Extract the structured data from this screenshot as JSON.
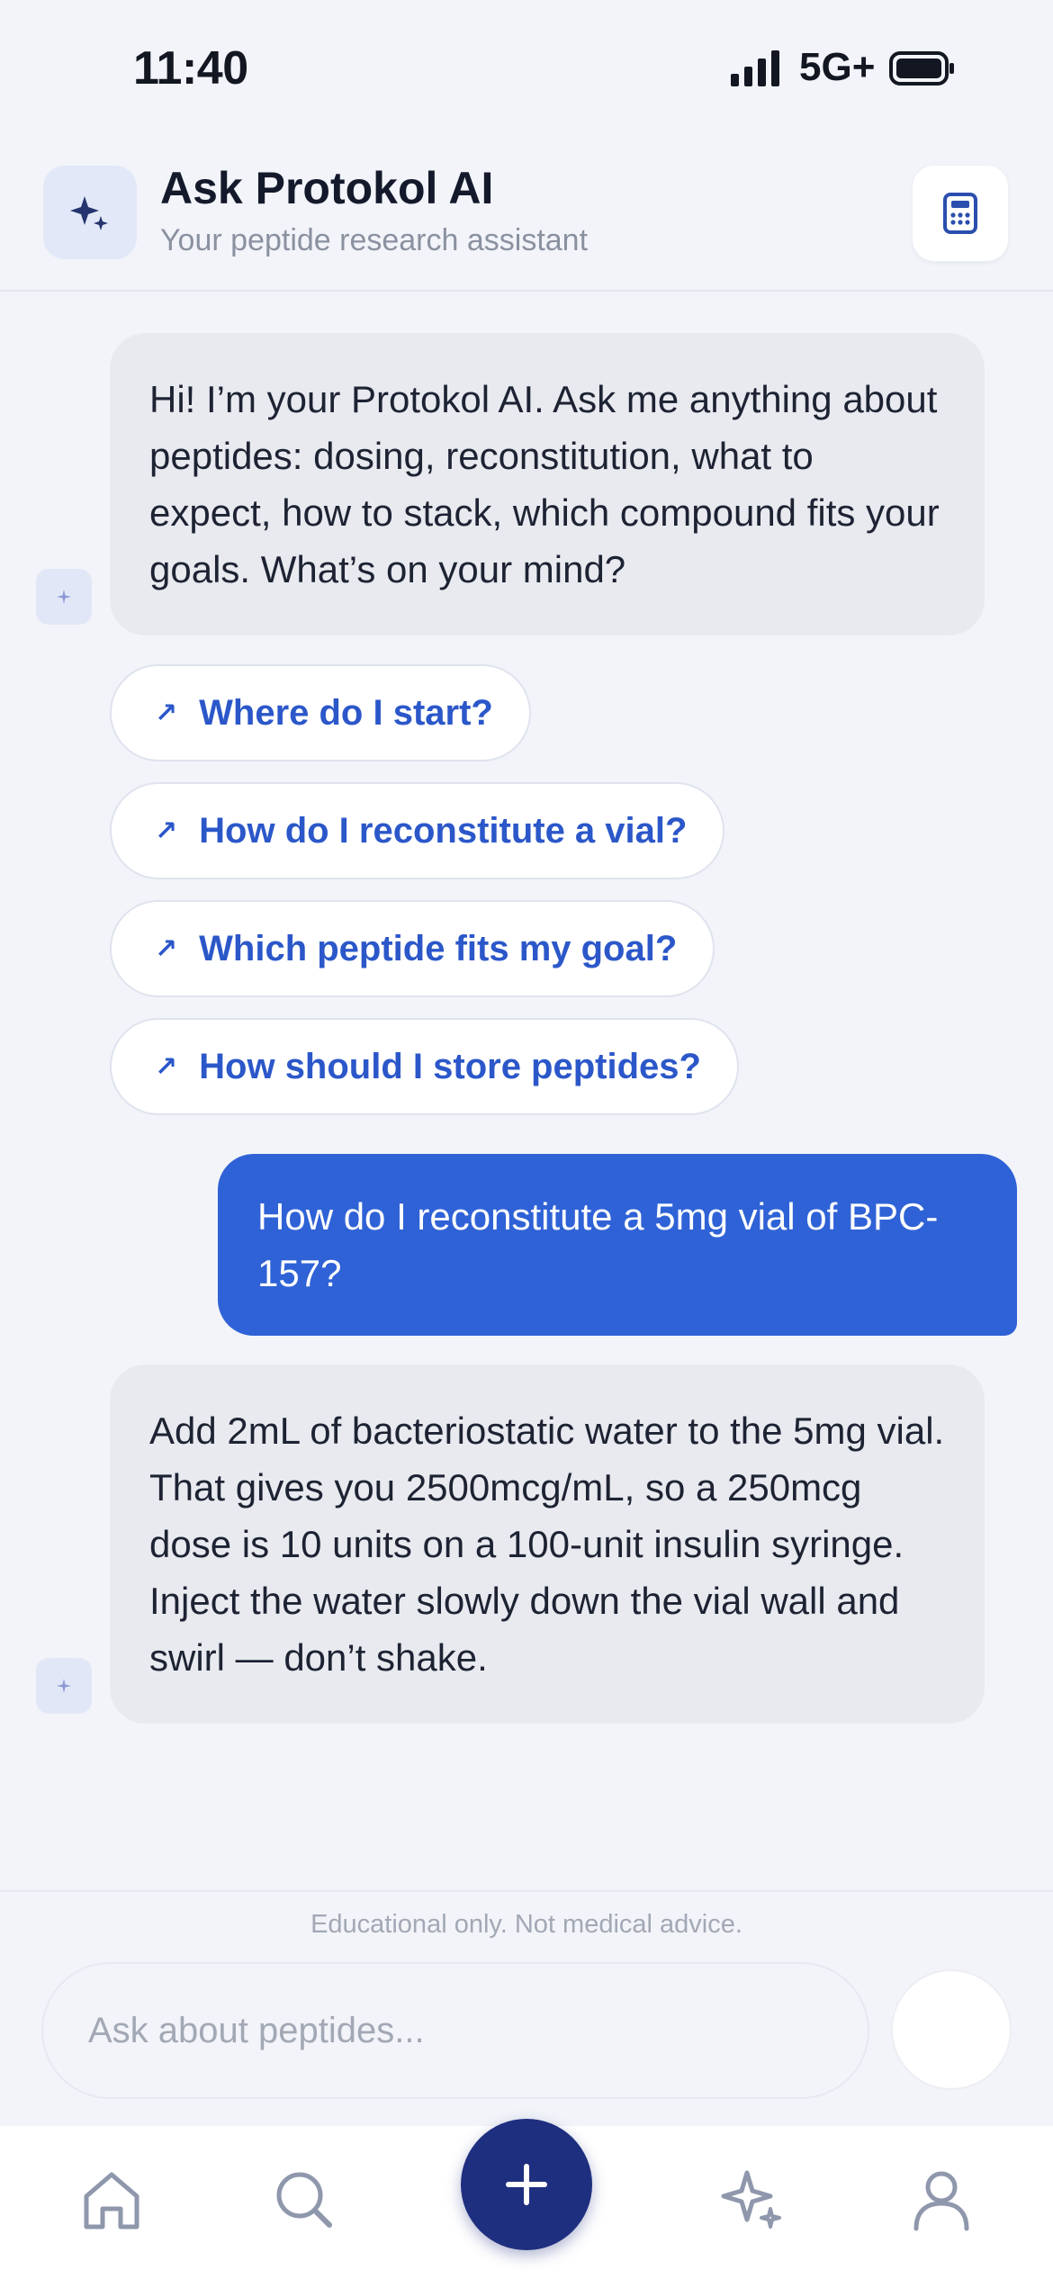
{
  "status_bar": {
    "time": "11:40",
    "network": "5G+",
    "icons": [
      "signal-icon",
      "battery-icon"
    ]
  },
  "header": {
    "title": "Ask Protokol AI",
    "subtitle": "Your peptide research assistant",
    "icons": [
      "sparkle-icon",
      "calculator-icon"
    ],
    "accent_bg": "#e2e8f8"
  },
  "messages": [
    {
      "role": "assistant",
      "text": "Hi! I’m your Protokol AI. Ask me anything about peptides: dosing, reconstitution, what to expect, how to stack, which compound fits your goals. What’s on your mind?"
    },
    {
      "role": "user",
      "text": "How do I reconstitute a 5mg vial of BPC-157?"
    },
    {
      "role": "assistant",
      "text": "Add 2mL of bacteriostatic water to the 5mg vial. That gives you 2500mcg/mL, so a 250mcg dose is 10 units on a 100-unit insulin syringe. Inject the water slowly down the vial wall and swirl — don’t shake."
    }
  ],
  "suggestions": [
    {
      "label": "Where do I start?",
      "icon": "arrow-up-right-icon"
    },
    {
      "label": "How do I reconstitute a vial?",
      "icon": "arrow-up-right-icon"
    },
    {
      "label": "Which peptide fits my goal?",
      "icon": "arrow-up-right-icon"
    },
    {
      "label": "How should I store peptides?",
      "icon": "arrow-up-right-icon"
    }
  ],
  "input": {
    "disclaimer": "Educational only. Not medical advice.",
    "placeholder": "Ask about peptides...",
    "value": ""
  },
  "tab_bar": {
    "tabs": [
      "home-icon",
      "search-icon",
      "add-icon",
      "sparkle-ai-icon",
      "profile-icon"
    ],
    "fab_color": "#1f2f7f"
  },
  "colors": {
    "primary": "#2f62d6",
    "link": "#2b57c9",
    "assistant_bubble": "#e8eaef",
    "background": "#f2f4f9"
  }
}
